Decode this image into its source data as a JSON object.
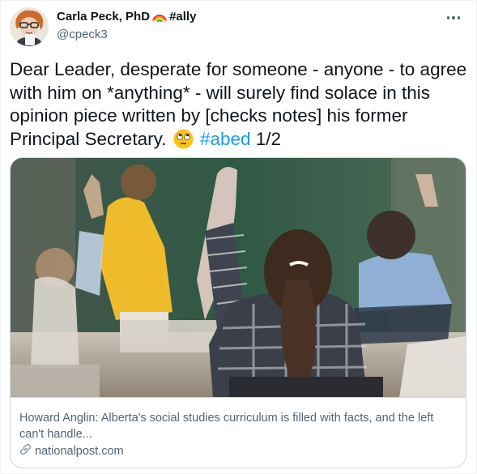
{
  "author": {
    "name": "Carla Peck, PhD",
    "name_tag": "#ally",
    "handle": "@cpeck3"
  },
  "tweet": {
    "text_main": "Dear Leader, desperate for someone - anyone - to agree with him on *anything* - will surely find solace in this opinion piece written by [checks notes] his former Principal Secretary.",
    "hashtag": "#abed",
    "thread_count": "1/2"
  },
  "card": {
    "title": "Howard Anglin: Alberta's social studies curriculum is filled with facts, and the left can't handle...",
    "domain": "nationalpost.com"
  },
  "colors": {
    "link": "#1d9bf0",
    "secondary_text": "#536471",
    "primary_text": "#0f1419"
  },
  "icons": {
    "more": "more-options-icon",
    "link": "link-icon",
    "emoji": "rolling-eyes-emoji",
    "name_emoji": "rainbow-emoji"
  }
}
